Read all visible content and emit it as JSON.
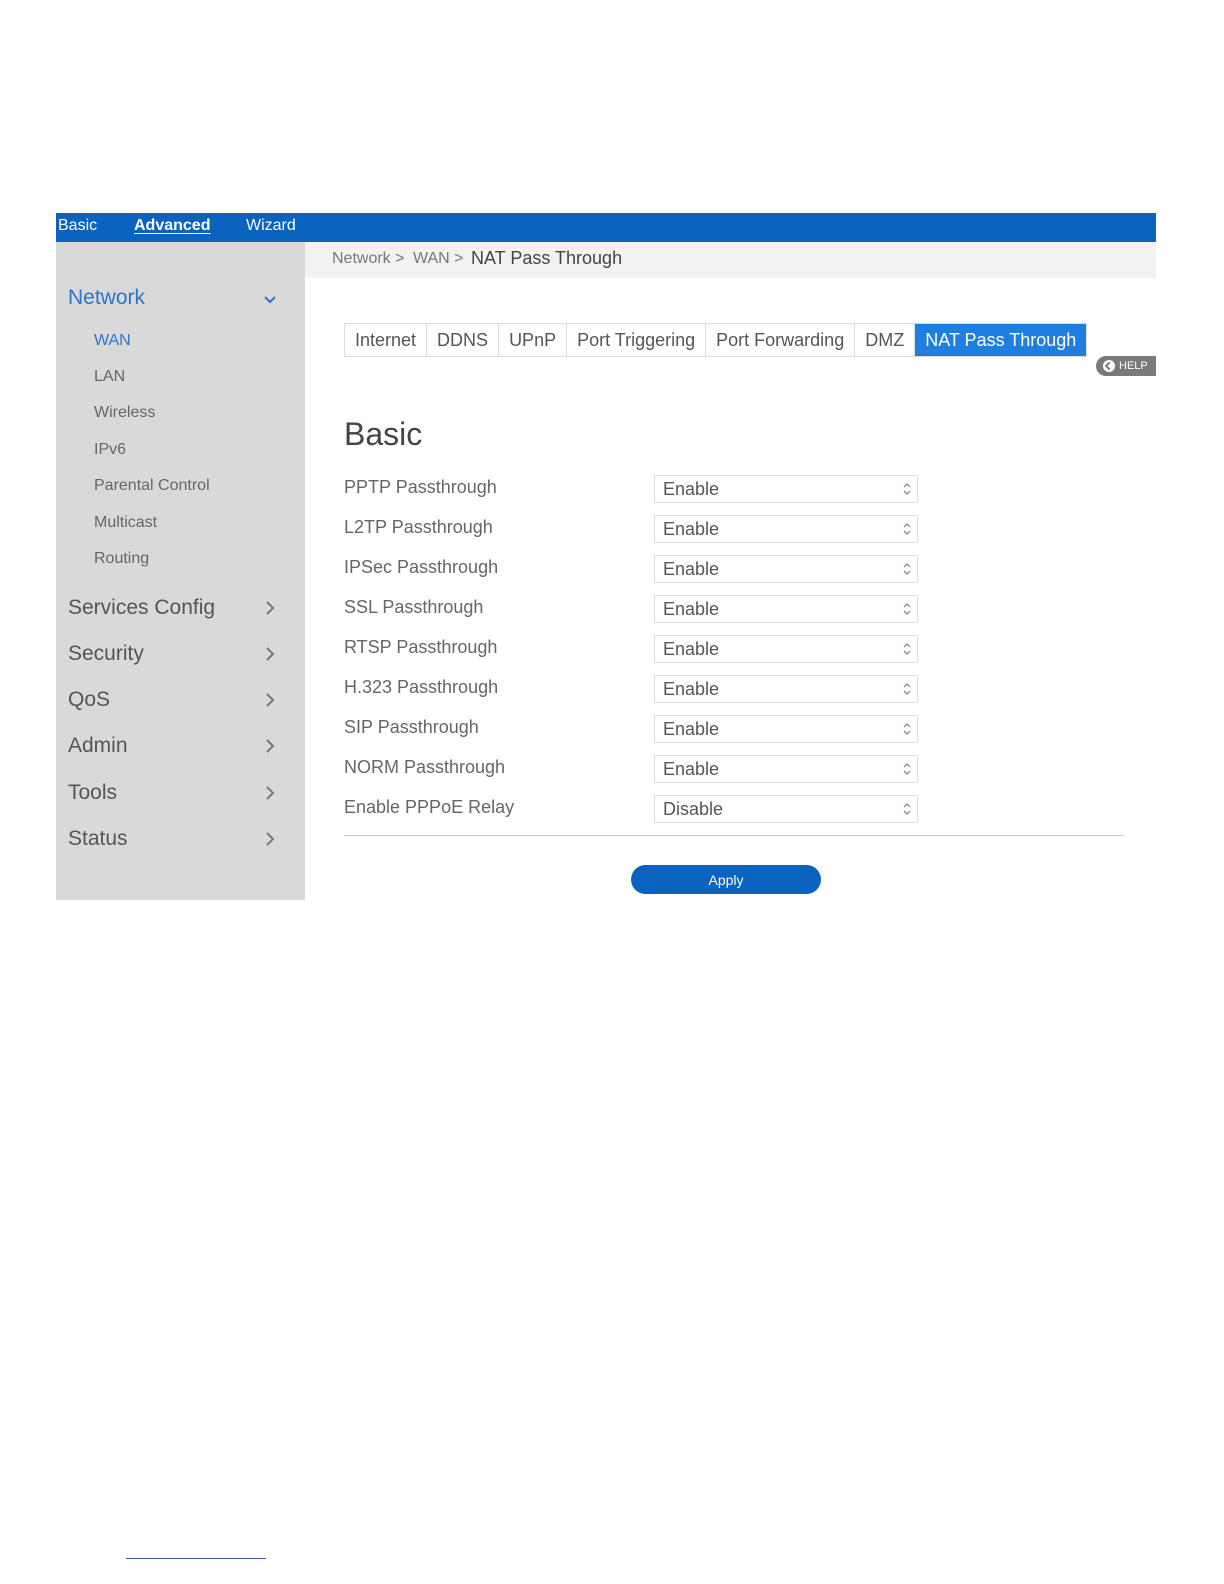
{
  "topnav": {
    "items": [
      {
        "label": "Basic",
        "active": false
      },
      {
        "label": "Advanced",
        "active": true
      },
      {
        "label": "Wizard",
        "active": false
      }
    ]
  },
  "sidebar": {
    "sections": [
      {
        "label": "Network",
        "expanded": true,
        "active": true,
        "subitems": [
          "WAN",
          "LAN",
          "Wireless",
          "IPv6",
          "Parental Control",
          "Multicast",
          "Routing"
        ],
        "active_subitem": "WAN"
      },
      {
        "label": "Services Config",
        "expanded": false
      },
      {
        "label": "Security",
        "expanded": false
      },
      {
        "label": "QoS",
        "expanded": false
      },
      {
        "label": "Admin",
        "expanded": false
      },
      {
        "label": "Tools",
        "expanded": false
      },
      {
        "label": "Status",
        "expanded": false
      }
    ]
  },
  "breadcrumb": {
    "parts": [
      "Network >",
      "WAN >"
    ],
    "current": "NAT Pass Through"
  },
  "tabs": [
    {
      "label": "Internet",
      "active": false
    },
    {
      "label": "DDNS",
      "active": false
    },
    {
      "label": "UPnP",
      "active": false
    },
    {
      "label": "Port Triggering",
      "active": false
    },
    {
      "label": "Port Forwarding",
      "active": false
    },
    {
      "label": "DMZ",
      "active": false
    },
    {
      "label": "NAT Pass Through",
      "active": true
    }
  ],
  "help": {
    "label": "HELP"
  },
  "form": {
    "title": "Basic",
    "rows": [
      {
        "label": "PPTP Passthrough",
        "value": "Enable"
      },
      {
        "label": "L2TP Passthrough",
        "value": "Enable"
      },
      {
        "label": "IPSec Passthrough",
        "value": "Enable"
      },
      {
        "label": "SSL Passthrough",
        "value": "Enable"
      },
      {
        "label": "RTSP Passthrough",
        "value": "Enable"
      },
      {
        "label": "H.323 Passthrough",
        "value": "Enable"
      },
      {
        "label": "SIP Passthrough",
        "value": "Enable"
      },
      {
        "label": "NORM Passthrough",
        "value": "Enable"
      },
      {
        "label": "Enable PPPoE Relay",
        "value": "Disable"
      }
    ],
    "apply_label": "Apply"
  },
  "colors": {
    "brand": "#0a63be",
    "active_tab": "#1f7fe0",
    "active_link": "#2b74c9",
    "sidebar_bg": "#d9d9d9"
  }
}
